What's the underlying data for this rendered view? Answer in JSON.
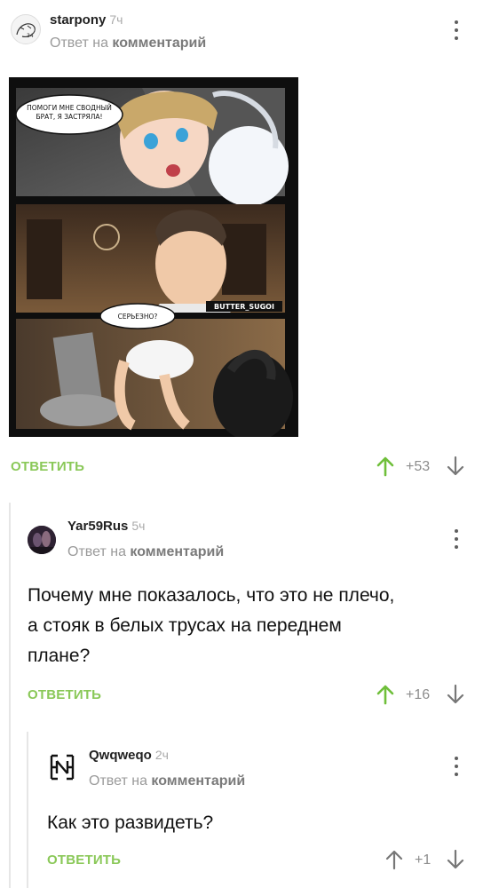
{
  "comments": [
    {
      "username": "starpony",
      "time": "7ч",
      "reply_to_prefix": "Ответ на",
      "reply_to_target": "комментарий",
      "text_lines": [],
      "reply_label": "ОТВЕТИТЬ",
      "score": "+53",
      "comic": {
        "bubble_1": "ПОМОГИ МНЕ СВОДНЫЙ БРАТ, Я ЗАСТРЯЛА!",
        "bubble_2": "СЕРЬЕЗНО?",
        "watermark": "BUTTER_SUGOI"
      }
    },
    {
      "username": "Yar59Rus",
      "time": "5ч",
      "reply_to_prefix": "Ответ на",
      "reply_to_target": "комментарий",
      "text_lines": [
        "Почему мне показалось, что это не плечо,",
        "а стояк в белых трусах на переднем",
        "плане?"
      ],
      "reply_label": "ОТВЕТИТЬ",
      "score": "+16"
    },
    {
      "username": "Qwqweqo",
      "time": "2ч",
      "reply_to_prefix": "Ответ на",
      "reply_to_target": "комментарий",
      "text_lines": [
        "Как это развидеть?"
      ],
      "reply_label": "ОТВЕТИТЬ",
      "score": "+1"
    }
  ],
  "colors": {
    "reply_green": "#8ac858",
    "upvote_green": "#6fbf3a",
    "downvote_gray": "#777777"
  },
  "icons": [
    "avatar",
    "kebab-menu-icon",
    "upvote-arrow-icon",
    "downvote-arrow-icon"
  ]
}
